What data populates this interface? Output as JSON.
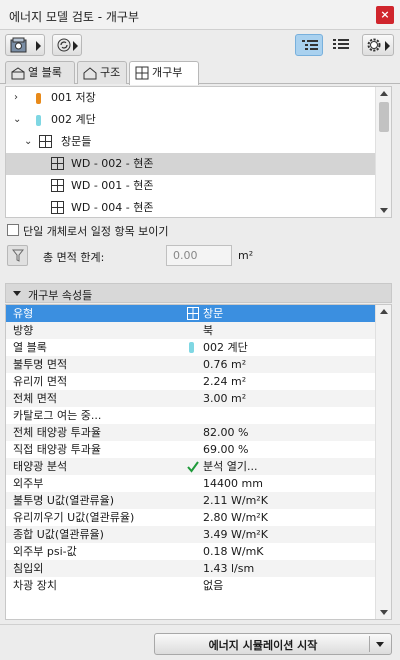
{
  "window": {
    "title": "에너지 모델 검토 - 개구부",
    "close": "×"
  },
  "tabs": [
    "열 블록",
    "구조",
    "개구부"
  ],
  "tree": {
    "rows": [
      {
        "label": "001 저장",
        "swatch": "#e88a1a"
      },
      {
        "label": "002 계단",
        "swatch": "#7fd7e3"
      },
      {
        "label": "창문들"
      },
      {
        "label": "WD - 002 - 현존"
      },
      {
        "label": "WD - 001 - 현존"
      },
      {
        "label": "WD - 004 - 현존"
      }
    ]
  },
  "check_label": "단일 개체로서 일정 항목 보이기",
  "filter": {
    "label": "총 면적 한계:",
    "value": "0.00",
    "unit": "m²"
  },
  "props_header": "개구부 속성들",
  "props": [
    {
      "k": "유형",
      "v": "창문"
    },
    {
      "k": "방향",
      "v": "북"
    },
    {
      "k": "열 블록",
      "v": "002 계단"
    },
    {
      "k": "불투명 면적",
      "v": "0.76 m²"
    },
    {
      "k": "유리끼 면적",
      "v": "2.24 m²"
    },
    {
      "k": "전체 면적",
      "v": "3.00 m²"
    },
    {
      "k": "카탈로그 여는 중...",
      "v": ""
    },
    {
      "k": "전체 태양광 투과율",
      "v": "82.00 %"
    },
    {
      "k": "직접 태양광 투과율",
      "v": "69.00 %"
    },
    {
      "k": "태양광 분석",
      "v": "분석 열기..."
    },
    {
      "k": "외주부",
      "v": "14400 mm"
    },
    {
      "k": "불투명 U값(열관류율)",
      "v": "2.11 W/m²K"
    },
    {
      "k": "유리끼우기 U값(열관류율)",
      "v": "2.80 W/m²K"
    },
    {
      "k": "종합 U값(열관류율)",
      "v": "3.49 W/m²K"
    },
    {
      "k": "외주부 psi-값",
      "v": "0.18 W/mK"
    },
    {
      "k": "침입외",
      "v": "1.43 l/sm"
    },
    {
      "k": "차광 장치",
      "v": "없음"
    }
  ],
  "start_button": "에너지 시뮬레이션 시작",
  "colors": {
    "accent": "#3b8fe0",
    "close": "#d0252c",
    "check": "#1f9a3a"
  }
}
